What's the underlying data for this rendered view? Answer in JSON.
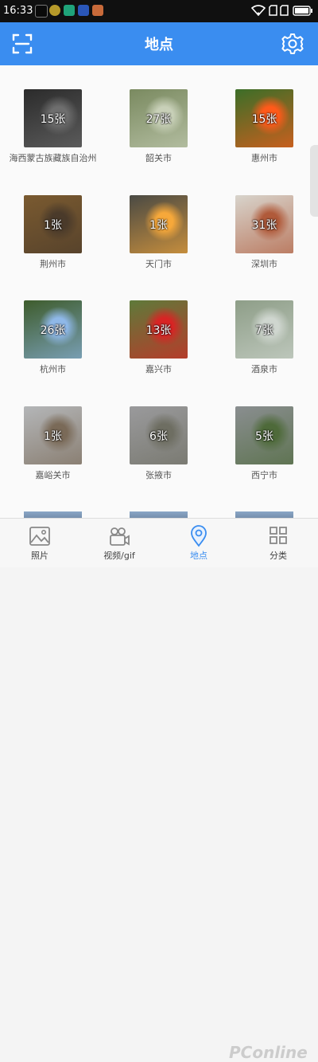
{
  "status": {
    "time": "16:33"
  },
  "header": {
    "title": "地点",
    "scan_icon": "scan-icon",
    "settings_icon": "gear-icon"
  },
  "places": [
    {
      "name": "海西蒙古族藏族自治州",
      "count": "15张",
      "bg": "#2b2b2b",
      "accent": "#6e6e6e"
    },
    {
      "name": "韶关市",
      "count": "27张",
      "bg": "#7a8a60",
      "accent": "#c8d0b8"
    },
    {
      "name": "惠州市",
      "count": "15张",
      "bg": "#3b6e28",
      "accent": "#ff5a1a"
    },
    {
      "name": "荆州市",
      "count": "1张",
      "bg": "#7a5a30",
      "accent": "#4a3a2a"
    },
    {
      "name": "天门市",
      "count": "1张",
      "bg": "#4a4a44",
      "accent": "#f6a83a"
    },
    {
      "name": "深圳市",
      "count": "31张",
      "bg": "#d8d4cc",
      "accent": "#b05a3a"
    },
    {
      "name": "杭州市",
      "count": "26张",
      "bg": "#3e5c2c",
      "accent": "#8fb8e8"
    },
    {
      "name": "嘉兴市",
      "count": "13张",
      "bg": "#5e7a3a",
      "accent": "#d82424"
    },
    {
      "name": "酒泉市",
      "count": "7张",
      "bg": "#8e9e88",
      "accent": "#cfd6cf"
    },
    {
      "name": "嘉峪关市",
      "count": "1张",
      "bg": "#b4b6b8",
      "accent": "#7a6a58"
    },
    {
      "name": "张掖市",
      "count": "6张",
      "bg": "#9a9a9c",
      "accent": "#6e6e62"
    },
    {
      "name": "西宁市",
      "count": "5张",
      "bg": "#8a8e90",
      "accent": "#4e6a3a"
    }
  ],
  "tabs": [
    {
      "label": "照片",
      "icon": "photo-icon"
    },
    {
      "label": "视频/gif",
      "icon": "video-camera-icon"
    },
    {
      "label": "地点",
      "icon": "location-pin-icon"
    },
    {
      "label": "分类",
      "icon": "category-icon"
    }
  ],
  "colors": {
    "primary": "#3a8df0"
  },
  "watermark": "PConline"
}
